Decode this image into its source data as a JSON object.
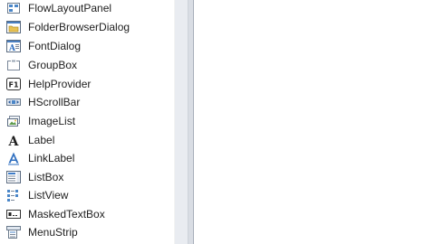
{
  "toolbox": {
    "items": [
      {
        "label": "FlowLayoutPanel",
        "icon": "flow-layout-panel-icon"
      },
      {
        "label": "FolderBrowserDialog",
        "icon": "folder-browser-dialog-icon"
      },
      {
        "label": "FontDialog",
        "icon": "font-dialog-icon"
      },
      {
        "label": "GroupBox",
        "icon": "group-box-icon"
      },
      {
        "label": "HelpProvider",
        "icon": "help-provider-icon"
      },
      {
        "label": "HScrollBar",
        "icon": "hscrollbar-icon"
      },
      {
        "label": "ImageList",
        "icon": "image-list-icon"
      },
      {
        "label": "Label",
        "icon": "label-icon"
      },
      {
        "label": "LinkLabel",
        "icon": "link-label-icon"
      },
      {
        "label": "ListBox",
        "icon": "list-box-icon"
      },
      {
        "label": "ListView",
        "icon": "list-view-icon"
      },
      {
        "label": "MaskedTextBox",
        "icon": "masked-text-box-icon"
      },
      {
        "label": "MenuStrip",
        "icon": "menu-strip-icon"
      }
    ],
    "icon_glyphs": {
      "font_dialog": "A",
      "help_provider": "F1",
      "label": "A"
    }
  },
  "colors": {
    "icon_blue": "#2f6fc0",
    "icon_dark": "#333333",
    "splitter": "#e9ecf1"
  }
}
